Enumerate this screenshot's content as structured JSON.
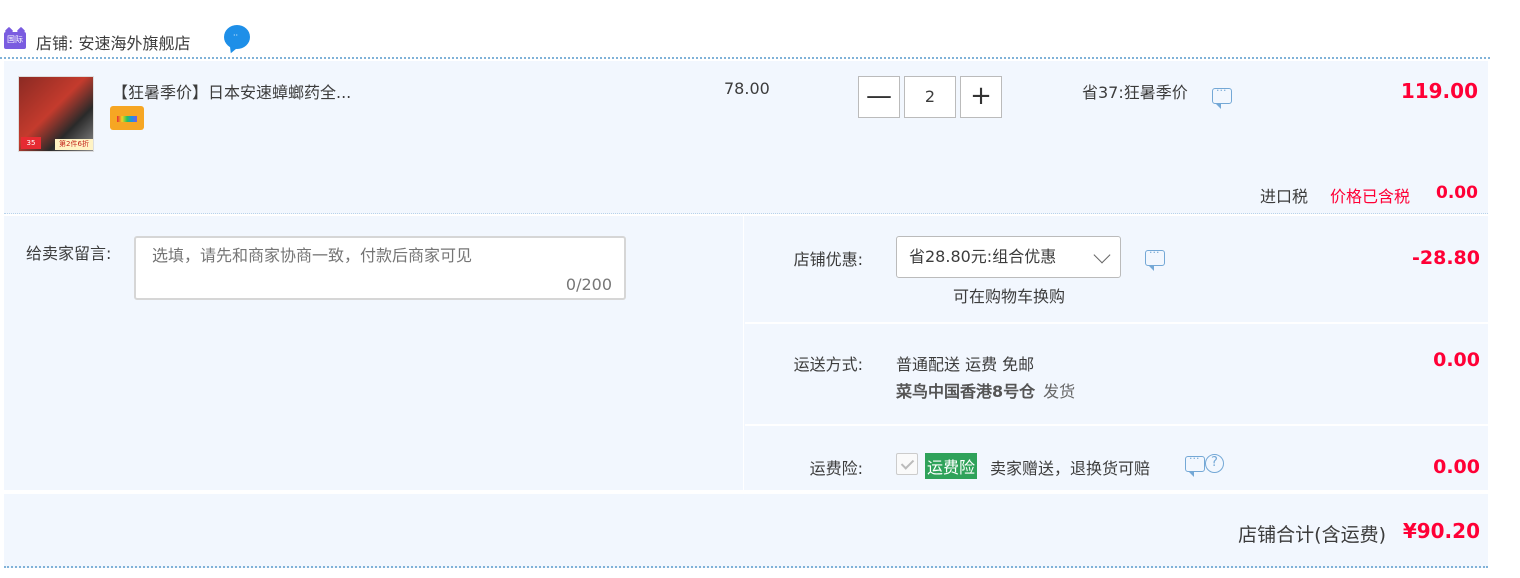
{
  "shop": {
    "badge_text": "国际",
    "label": "店铺: 安速海外旗舰店",
    "chat_icon": "wangwang-chat-icon"
  },
  "item": {
    "thumb_badge_price": "35",
    "thumb_badge_promo": "第2件6折",
    "title": "【狂暑季价】日本安速蟑螂药全...",
    "unit_price": "78.00",
    "quantity": "2",
    "minus_label": "—",
    "plus_label": "+",
    "promo_text": "省37:狂暑季价",
    "subtotal": "119.00",
    "tax_label": "进口税",
    "tax_note": "价格已含税",
    "tax_value": "0.00"
  },
  "note": {
    "label": "给卖家留言:",
    "placeholder": "选填，请先和商家协商一致，付款后商家可见",
    "counter": "0/200"
  },
  "discount": {
    "label": "店铺优惠:",
    "selected": "省28.80元:组合优惠",
    "sub_text": "可在购物车换购",
    "value": "-28.80"
  },
  "shipping": {
    "label": "运送方式:",
    "method": "普通配送 运费 免邮",
    "warehouse": "菜鸟中国香港8号仓",
    "warehouse_suffix": "发货",
    "value": "0.00"
  },
  "insurance": {
    "label": "运费险:",
    "tag": "运费险",
    "text": "卖家赠送，退换货可赔",
    "help_glyph": "?",
    "value": "0.00"
  },
  "footer": {
    "total_label": "店铺合计(含运费)",
    "total_value": "¥90.20"
  },
  "colors": {
    "price_red": "#ff0036",
    "panel_bg": "#f2f7fe",
    "badge_purple": "#7a5ce0",
    "chat_blue": "#1e8fe8",
    "insurance_green": "#2fa25a"
  }
}
